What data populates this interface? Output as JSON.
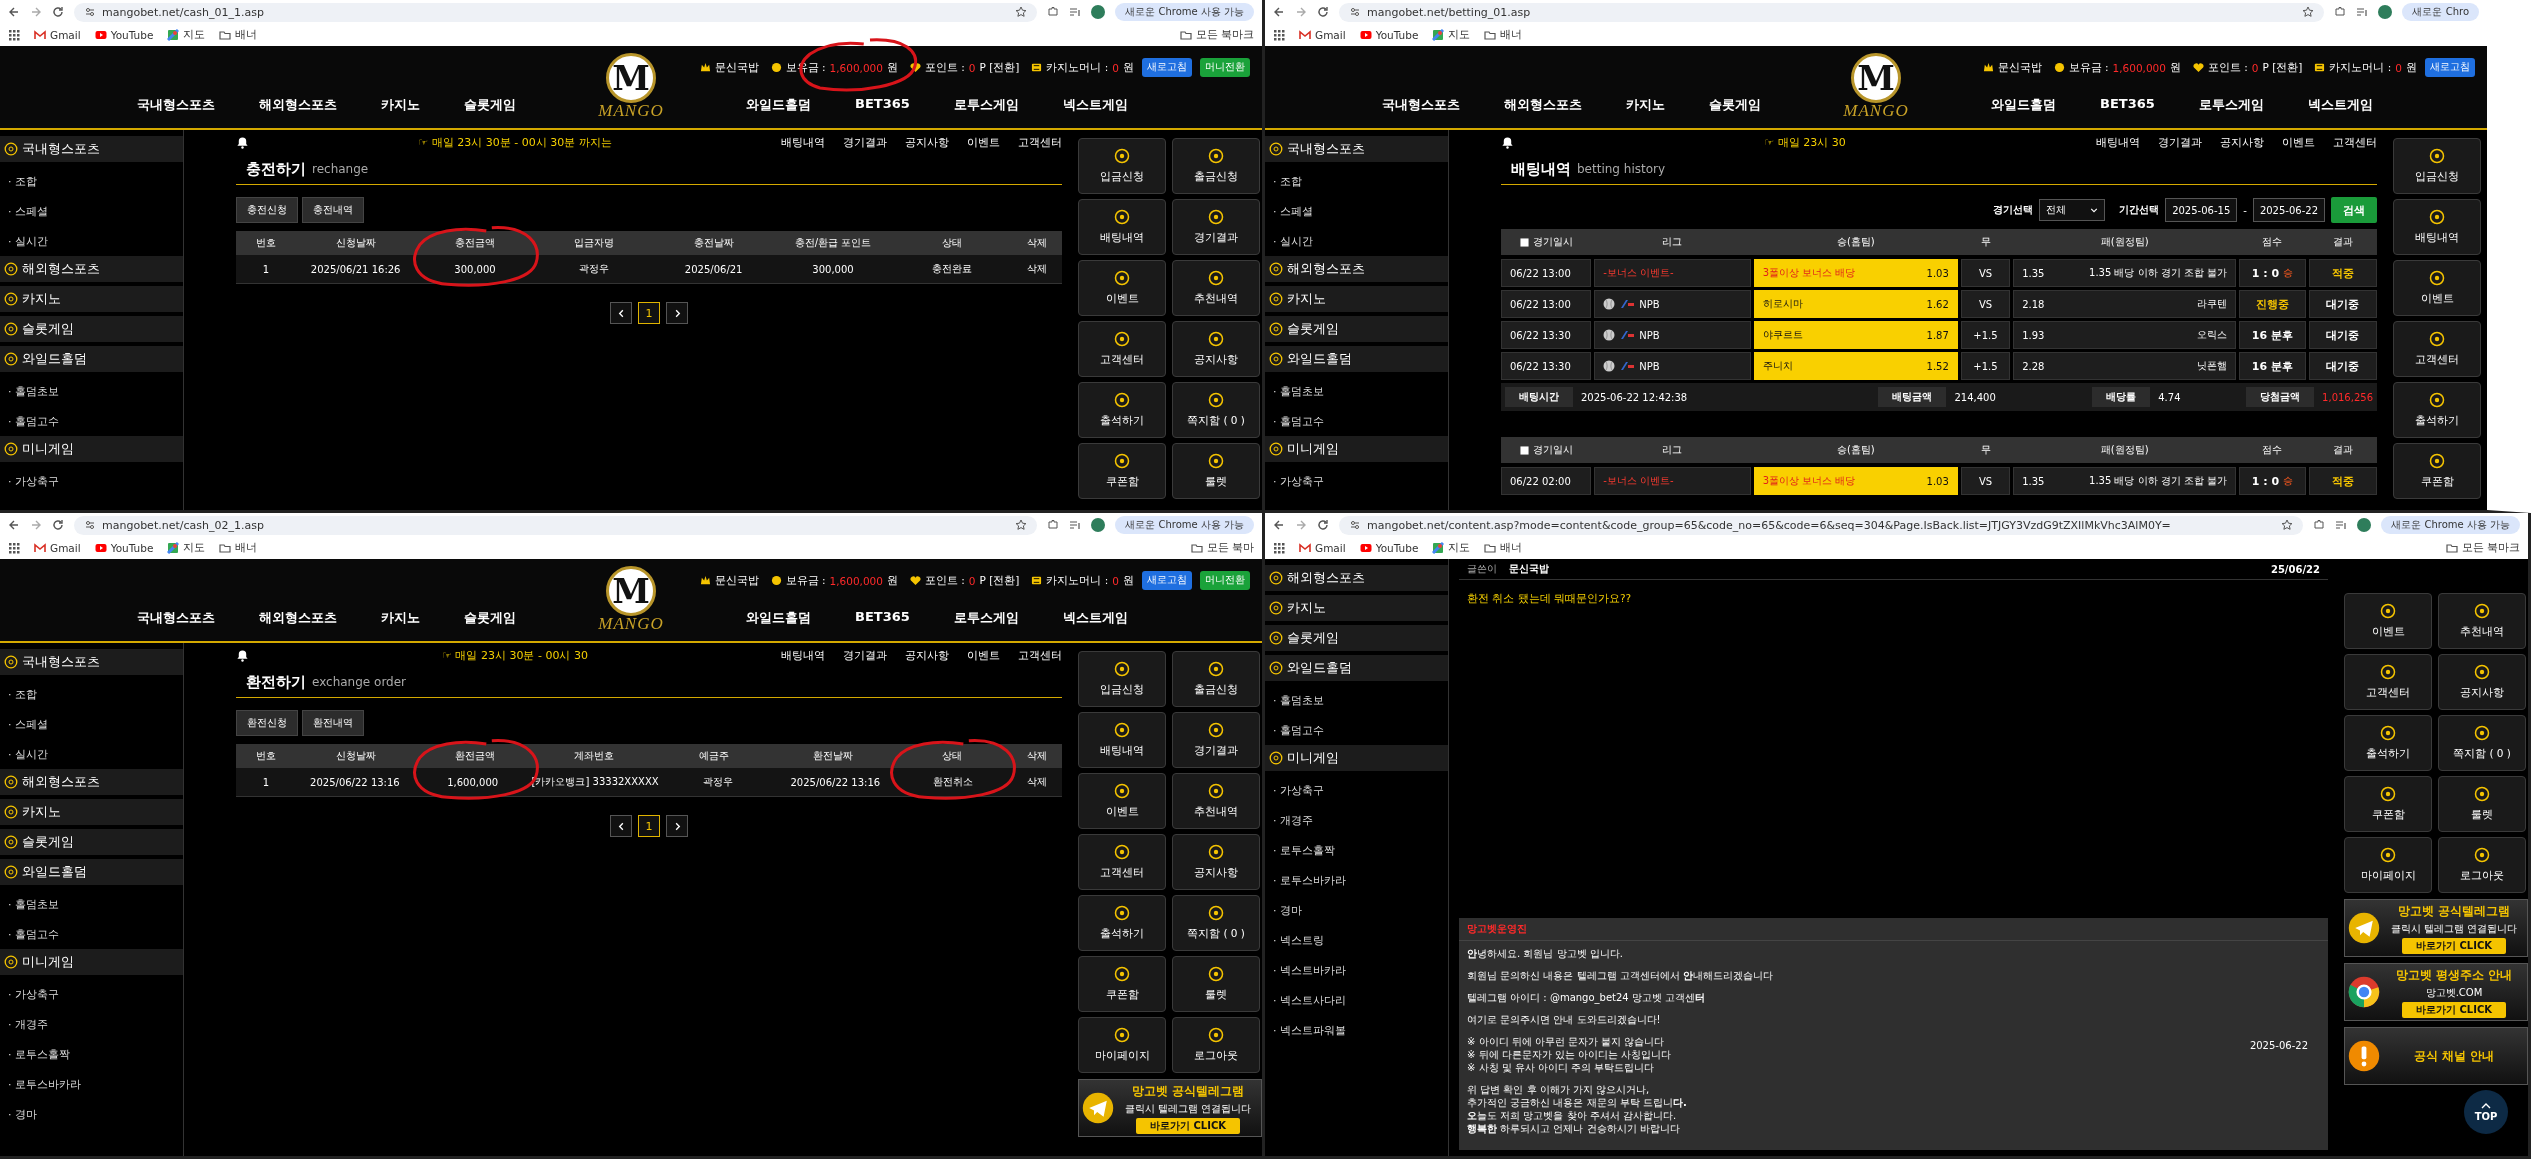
{
  "panels": [
    {
      "cropped_right": false,
      "browser": {
        "url": "mangobet.net/cash_01_1.asp",
        "update_pill": "새로운 Chrome 사용 가능",
        "bookmarks": [
          {
            "label": "Gmail",
            "kind": "mail"
          },
          {
            "label": "YouTube",
            "kind": "video"
          },
          {
            "label": "지도",
            "kind": "map"
          },
          {
            "label": "배너",
            "kind": "folder"
          }
        ],
        "all_bookmarks": "모든 북마크"
      },
      "header": {
        "user": "문신국밥",
        "balance_label": "보유금 :",
        "balance": "1,600,000",
        "balance_unit": "원",
        "balance_circled": true,
        "point_label": "포인트 :",
        "point": "0",
        "point_unit": "P [전환]",
        "casino_label": "카지노머니 :",
        "casino": "0",
        "casino_unit": "원",
        "buttons": [
          {
            "label": "새로고침",
            "kind": "refresh"
          },
          {
            "label": "머니전환",
            "kind": "convert"
          }
        ],
        "logo_letter": "M",
        "logo_text": "MANGO",
        "nav_left": [
          "국내형스포츠",
          "해외형스포츠",
          "카지노",
          "슬롯게임"
        ],
        "nav_right": [
          "와일드홀덤",
          "BET365",
          "로투스게임",
          "넥스트게임"
        ]
      },
      "notice": {
        "ticker": "☞ 매일 23시 30분 - 00시 30분 까지는",
        "links": [
          "배팅내역",
          "경기결과",
          "공지사항",
          "이벤트",
          "고객센터"
        ]
      },
      "sidebar": [
        {
          "label": "국내형스포츠",
          "children": [
            "· 조합",
            "· 스페셜",
            "· 실시간"
          ]
        },
        {
          "label": "해외형스포츠"
        },
        {
          "label": "카지노"
        },
        {
          "label": "슬롯게임"
        },
        {
          "label": "와일드홀덤",
          "children": [
            "· 홀덤초보",
            "· 홀덤고수"
          ]
        },
        {
          "label": "미니게임",
          "children": [
            "· 가상축구"
          ]
        }
      ],
      "content": {
        "kind": "cash_history",
        "title": "충전하기",
        "subtitle": "rechange",
        "tabs": [
          "충전신청",
          "충전내역"
        ],
        "columns": [
          {
            "label": "번호",
            "circled": false
          },
          {
            "label": "신청날짜",
            "circled": false
          },
          {
            "label": "충전금액",
            "circled": true
          },
          {
            "label": "입금자명",
            "circled": false
          },
          {
            "label": "충전날짜",
            "circled": false
          },
          {
            "label": "충전/환급 포인트",
            "circled": false
          },
          {
            "label": "상태",
            "circled": false
          },
          {
            "label": "삭제",
            "circled": false
          }
        ],
        "rows": [
          [
            "1",
            "2025/06/21 16:26",
            "300,000",
            "곽정우",
            "2025/06/21",
            "300,000",
            "충전완료",
            "삭제"
          ]
        ],
        "page": "1"
      },
      "quick_menu": [
        "입금신청",
        "출금신청",
        "배팅내역",
        "경기결과",
        "이벤트",
        "추천내역",
        "고객센터",
        "공지사항",
        "출석하기",
        "쪽지함 ( 0 )",
        "쿠폰함",
        "룰렛"
      ]
    },
    {
      "cropped_right": true,
      "browser": {
        "url": "mangobet.net/betting_01.asp",
        "update_pill": "새로운 Chro",
        "bookmarks": [
          {
            "label": "Gmail",
            "kind": "mail"
          },
          {
            "label": "YouTube",
            "kind": "video"
          },
          {
            "label": "지도",
            "kind": "map"
          },
          {
            "label": "배너",
            "kind": "folder"
          }
        ]
      },
      "header": {
        "user": "문신국밥",
        "balance_label": "보유금 :",
        "balance": "1,600,000",
        "balance_unit": "원",
        "balance_circled": false,
        "point_label": "포인트 :",
        "point": "0",
        "point_unit": "P [전환]",
        "casino_label": "카지노머니 :",
        "casino": "0",
        "casino_unit": "원",
        "buttons": [
          {
            "label": "새로고침",
            "kind": "refresh"
          }
        ],
        "logo_letter": "M",
        "logo_text": "MANGO",
        "nav_left": [
          "국내형스포츠",
          "해외형스포츠",
          "카지노",
          "슬롯게임"
        ],
        "nav_right": [
          "와일드홀덤",
          "BET365",
          "로투스게임",
          "넥스트게임"
        ]
      },
      "notice": {
        "ticker": "☞ 매일 23시 30",
        "links": [
          "배팅내역",
          "경기결과",
          "공지사항",
          "이벤트",
          "고객센터"
        ]
      },
      "sidebar": [
        {
          "label": "국내형스포츠",
          "children": [
            "· 조합",
            "· 스페셜",
            "· 실시간"
          ]
        },
        {
          "label": "해외형스포츠"
        },
        {
          "label": "카지노"
        },
        {
          "label": "슬롯게임"
        },
        {
          "label": "와일드홀덤",
          "children": [
            "· 홀덤초보",
            "· 홀덤고수"
          ]
        },
        {
          "label": "미니게임",
          "children": [
            "· 가상축구"
          ]
        }
      ],
      "content": {
        "kind": "betting_history",
        "title": "배팅내역",
        "subtitle": "betting history",
        "filter": {
          "game_label": "경기선택",
          "game_value": "전체",
          "period_label": "기간선택",
          "from": "2025-06-15",
          "separator": "-",
          "to": "2025-06-22",
          "search": "검색"
        },
        "groups": [
          {
            "checked": false,
            "columns": [
              "경기일시",
              "리그",
              "승(홈팀)",
              "무",
              "패(원정팀)",
              "점수",
              "결과"
            ],
            "rows": [
              {
                "time": "06/22 13:00",
                "kind": "event",
                "league": "-보너스 이벤트-",
                "home": "3폴이상 보너스 배당",
                "home_odds": "1.03",
                "draw": "VS",
                "away_odds": "1.35",
                "away": "1.35 배당 이하 경기 조합 불가",
                "score": {
                  "text": "1 : 0",
                  "mark": "승",
                  "color": "#ffffff"
                },
                "result": {
                  "text": "적중",
                  "color": "#f5c400"
                }
              },
              {
                "time": "06/22 13:00",
                "kind": "league",
                "league": "NPB",
                "home": "히로시마",
                "home_odds": "1.62",
                "draw": "VS",
                "away_odds": "2.18",
                "away": "라쿠텐",
                "score": {
                  "text": "진행중",
                  "color": "#f5c400"
                },
                "result": {
                  "text": "대기중",
                  "color": "#ffffff"
                }
              },
              {
                "time": "06/22 13:30",
                "kind": "league",
                "league": "NPB",
                "home": "야쿠르트",
                "home_odds": "1.87",
                "draw": "+1.5",
                "away_odds": "1.93",
                "away": "오릭스",
                "score": {
                  "text": "16 분후",
                  "color": "#ffffff"
                },
                "result": {
                  "text": "대기중",
                  "color": "#ffffff"
                }
              },
              {
                "time": "06/22 13:30",
                "kind": "league",
                "league": "NPB",
                "home": "주니치",
                "home_odds": "1.52",
                "draw": "+1.5",
                "away_odds": "2.28",
                "away": "닛폰햄",
                "score": {
                  "text": "16 분후",
                  "color": "#ffffff"
                },
                "result": {
                  "text": "대기중",
                  "color": "#ffffff"
                }
              }
            ],
            "summary": {
              "time_label": "배팅시간",
              "time": "2025-06-22 12:42:38",
              "amount_label": "배팅금액",
              "amount": "214,400",
              "rate_label": "배당률",
              "rate": "4.74",
              "win_label": "당첨금액",
              "win": "1,016,256"
            }
          },
          {
            "checked": false,
            "columns": [
              "경기일시",
              "리그",
              "승(홈팀)",
              "무",
              "패(원정팀)",
              "점수",
              "결과"
            ],
            "rows": [
              {
                "time": "06/22 02:00",
                "kind": "event",
                "league": "-보너스 이벤트-",
                "home": "3폴이상 보너스 배당",
                "home_odds": "1.03",
                "draw": "VS",
                "away_odds": "1.35",
                "away": "1.35 배당 이하 경기 조합 불가",
                "score": {
                  "text": "1 : 0",
                  "mark": "승",
                  "color": "#ffffff"
                },
                "result": {
                  "text": "적중",
                  "color": "#f5c400"
                }
              }
            ]
          }
        ]
      },
      "quick_menu": [
        "입금신청",
        "배팅내역",
        "이벤트",
        "고객센터",
        "출석하기",
        "쿠폰함"
      ]
    },
    {
      "cropped_right": false,
      "browser": {
        "url": "mangobet.net/cash_02_1.asp",
        "update_pill": "새로운 Chrome 사용 가능",
        "bookmarks": [
          {
            "label": "Gmail",
            "kind": "mail"
          },
          {
            "label": "YouTube",
            "kind": "video"
          },
          {
            "label": "지도",
            "kind": "map"
          },
          {
            "label": "배너",
            "kind": "folder"
          }
        ],
        "all_bookmarks": "모든 북마"
      },
      "header": {
        "user": "문신국밥",
        "balance_label": "보유금 :",
        "balance": "1,600,000",
        "balance_unit": "원",
        "balance_circled": false,
        "point_label": "포인트 :",
        "point": "0",
        "point_unit": "P [전환]",
        "casino_label": "카지노머니 :",
        "casino": "0",
        "casino_unit": "원",
        "buttons": [
          {
            "label": "새로고침",
            "kind": "refresh"
          },
          {
            "label": "머니전환",
            "kind": "convert"
          }
        ],
        "logo_letter": "M",
        "logo_text": "MANGO",
        "nav_left": [
          "국내형스포츠",
          "해외형스포츠",
          "카지노",
          "슬롯게임"
        ],
        "nav_right": [
          "와일드홀덤",
          "BET365",
          "로투스게임",
          "넥스트게임"
        ]
      },
      "notice": {
        "ticker": "☞ 매일 23시 30분 - 00시 30",
        "links": [
          "배팅내역",
          "경기결과",
          "공지사항",
          "이벤트",
          "고객센터"
        ]
      },
      "sidebar": [
        {
          "label": "국내형스포츠",
          "children": [
            "· 조합",
            "· 스페셜",
            "· 실시간"
          ]
        },
        {
          "label": "해외형스포츠"
        },
        {
          "label": "카지노"
        },
        {
          "label": "슬롯게임"
        },
        {
          "label": "와일드홀덤",
          "children": [
            "· 홀덤초보",
            "· 홀덤고수"
          ]
        },
        {
          "label": "미니게임",
          "children": [
            "· 가상축구",
            "· 개경주",
            "· 로투스홀짝",
            "· 로투스바카라",
            "· 경마"
          ]
        }
      ],
      "content": {
        "kind": "cash_history",
        "title": "환전하기",
        "subtitle": "exchange order",
        "tabs": [
          "환전신청",
          "환전내역"
        ],
        "columns": [
          {
            "label": "번호",
            "circled": false
          },
          {
            "label": "신청날짜",
            "circled": false
          },
          {
            "label": "환전금액",
            "circled": true
          },
          {
            "label": "계좌번호",
            "circled": false
          },
          {
            "label": "예금주",
            "circled": false
          },
          {
            "label": "환전날짜",
            "circled": false
          },
          {
            "label": "상태",
            "circled": true
          },
          {
            "label": "삭제",
            "circled": false
          }
        ],
        "rows": [
          [
            "1",
            "2025/06/22 13:16",
            "1,600,000",
            "[카카오뱅크] 33332XXXXX",
            "곽정우",
            "2025/06/22 13:16",
            "환전취소",
            "삭제"
          ]
        ],
        "page": "1"
      },
      "quick_menu": [
        "입금신청",
        "출금신청",
        "배팅내역",
        "경기결과",
        "이벤트",
        "추천내역",
        "고객센터",
        "공지사항",
        "출석하기",
        "쪽지함 ( 0 )",
        "쿠폰함",
        "룰렛",
        "마이페이지",
        "로그아웃"
      ],
      "banners": [
        {
          "kind": "telegram",
          "title": "망고벳 공식텔레그램",
          "text": "클릭시 텔레그램 연결됩니다",
          "action": "바로가기 CLICK"
        }
      ]
    },
    {
      "cropped_right": false,
      "browser": {
        "url": "mangobet.net/content.asp?mode=content&code_group=65&code_no=65&code=6&seq=304&Page.IsBack.list=JTJGY3VzdG9tZXIlMkVhc3AlM0Y=",
        "update_pill": "새로운 Chrome 사용 가능",
        "bookmarks": [
          {
            "label": "Gmail",
            "kind": "mail"
          },
          {
            "label": "YouTube",
            "kind": "video"
          },
          {
            "label": "지도",
            "kind": "map"
          },
          {
            "label": "배너",
            "kind": "folder"
          }
        ],
        "all_bookmarks": "모든 북마크"
      },
      "sidebar": [
        {
          "label": "해외형스포츠"
        },
        {
          "label": "카지노"
        },
        {
          "label": "슬롯게임"
        },
        {
          "label": "와일드홀덤",
          "children": [
            "· 홀덤초보",
            "· 홀덤고수"
          ]
        },
        {
          "label": "미니게임",
          "children": [
            "· 가상축구",
            "· 개경주",
            "· 로투스홀짝",
            "· 로투스바카라",
            "· 경마",
            "· 넥스트링",
            "· 넥스트바카라",
            "· 넥스트사다리",
            "· 넥스트파워볼"
          ]
        }
      ],
      "content": {
        "kind": "board_post",
        "author_label": "글쓴이",
        "author": "문신국밥",
        "date": "25/06/22",
        "question": "환전 취소 됐는데 뭐때문인가요??",
        "reply": {
          "author": "망고벳운영진",
          "date": "2025-06-22",
          "paragraphs": [
            [
              "**안**녕하세요. 회원님 망고벳 입니다."
            ],
            [
              "회원님 문의하신 내용은 텔레그램 고객센터에서 **안**내해드리겠습니다"
            ],
            [
              "텔레그램 아이디 : @mango_bet24 망고벳 고객센**터**"
            ],
            [
              "여기로 문의주시면  안내 도와드리겠습니다!"
            ],
            [
              "※ 아이디 뒤에 아무런 문자가 붙지 않습니다",
              "※ 뒤에 다른문자가 있는 아이디는 사칭입니다",
              "※ 사칭 및 유사 아이디 주의 부탁드립니다"
            ],
            [
              "위 답변 확인 후 이해가 가지 않으시거나,",
              "추가적인 궁금하신 내용은 재문의 부탁 드립니**다.**",
              "**오**늘도 저희 망고벳을 찾아 주셔서 감사합니다.",
              "**행복한** 하루되시고 언제나 건승하시기 바랍니다"
            ]
          ]
        }
      },
      "quick_menu": [
        "이벤트",
        "추천내역",
        "고객센터",
        "공지사항",
        "출석하기",
        "쪽지함 ( 0 )",
        "쿠폰함",
        "룰렛",
        "마이페이지",
        "로그아웃"
      ],
      "banners": [
        {
          "kind": "telegram",
          "title": "망고벳 공식텔레그램",
          "text": "클릭시 텔레그램 연결됩니다",
          "action": "바로가기 CLICK"
        },
        {
          "kind": "browser",
          "title": "망고벳 평생주소 안내",
          "text": "망고벳.COM",
          "action": "바로가기 CLICK"
        },
        {
          "kind": "alert",
          "title": "공식 채널 안내"
        }
      ],
      "top_button": "TOP"
    }
  ]
}
